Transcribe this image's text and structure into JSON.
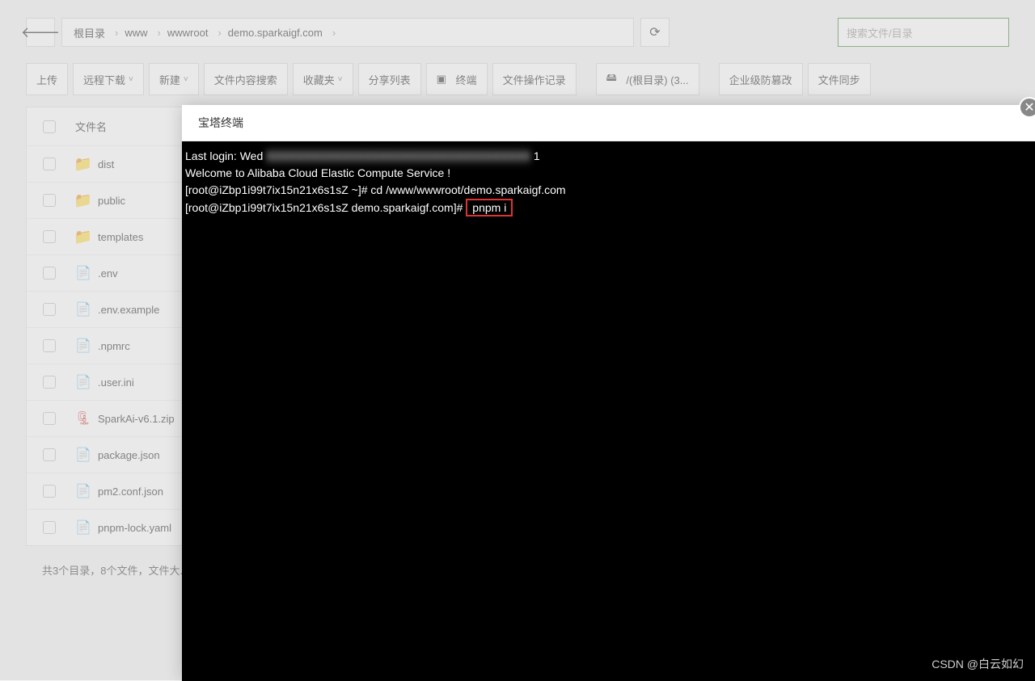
{
  "breadcrumb": {
    "root": "根目录",
    "path": [
      "www",
      "wwwroot",
      "demo.sparkaigf.com"
    ]
  },
  "search_placeholder": "搜索文件/目录",
  "toolbar": {
    "upload": "上传",
    "remote_download": "远程下载",
    "new": "新建",
    "content_search": "文件内容搜索",
    "favorites": "收藏夹",
    "share_list": "分享列表",
    "terminal": "终端",
    "file_ops": "文件操作记录",
    "disk": "/(根目录) (3...",
    "tamper": "企业级防篡改",
    "sync": "文件同步"
  },
  "list_header": "文件名",
  "files": [
    {
      "name": "dist",
      "type": "folder"
    },
    {
      "name": "public",
      "type": "folder"
    },
    {
      "name": "templates",
      "type": "folder"
    },
    {
      "name": ".env",
      "type": "file"
    },
    {
      "name": ".env.example",
      "type": "file"
    },
    {
      "name": ".npmrc",
      "type": "file"
    },
    {
      "name": ".user.ini",
      "type": "file"
    },
    {
      "name": "SparkAi-v6.1.zip",
      "type": "zip"
    },
    {
      "name": "package.json",
      "type": "json"
    },
    {
      "name": "pm2.conf.json",
      "type": "json"
    },
    {
      "name": "pnpm-lock.yaml",
      "type": "file"
    }
  ],
  "footer_stats": "共3个目录，8个文件，文件大...",
  "modal_title": "宝塔终端",
  "terminal_output": {
    "line1": "Last login: Wed ",
    "line1b_hidden": "XXXXXXXXXXXXXXXXXXXXXXXXXXXXXXXXXXX",
    "line1c": " 1",
    "line2": "",
    "line3": "Welcome to Alibaba Cloud Elastic Compute Service !",
    "line4": "",
    "line5_prompt": "[root@iZbp1i99t7ix15n21x6s1sZ ~]# cd /www/wwwroot/demo.sparkaigf.com",
    "line6_prompt": "[root@iZbp1i99t7ix15n21x6s1sZ demo.sparkaigf.com]# ",
    "line6_cmd": "pnpm i"
  },
  "watermark": "CSDN @白云如幻"
}
